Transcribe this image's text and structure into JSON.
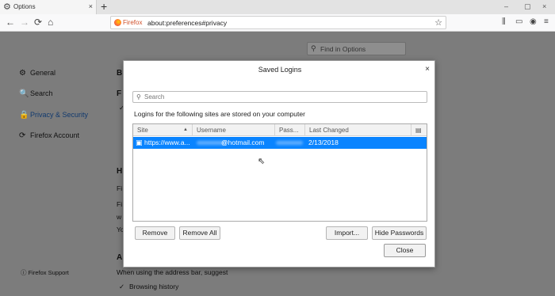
{
  "tab": {
    "title": "Options",
    "close": "×",
    "new_tab": "+"
  },
  "window_controls": {
    "minimize": "‒",
    "restore": "▢",
    "close": "×"
  },
  "nav": {
    "back": "←",
    "forward": "→",
    "reload": "⟳",
    "home": "⌂"
  },
  "urlbar": {
    "identity": "Firefox",
    "url": "about:preferences#privacy",
    "bookmark": "☆"
  },
  "toolbar_icons": {
    "library": "⫼",
    "sidebar": "▭",
    "account": "◉",
    "menu": "≡"
  },
  "page": {
    "find_placeholder": "Find in Options",
    "sidebar": [
      {
        "label": "General",
        "icon": "⚙"
      },
      {
        "label": "Search",
        "icon": "🔍"
      },
      {
        "label": "Privacy & Security",
        "icon": "🔒"
      },
      {
        "label": "Firefox Account",
        "icon": "⟳"
      }
    ],
    "support": "Firefox Support",
    "bg": {
      "b1": "B",
      "f1": "F",
      "check1": "✓",
      "h1": "H",
      "fi1": "Fi",
      "fi2": "Fi",
      "we": "w",
      "yo": "Yo",
      "a1": "A",
      "address_bar": "When using the address bar, suggest",
      "browsing_history": "Browsing history",
      "check2": "✓"
    }
  },
  "dialog": {
    "title": "Saved Logins",
    "close": "×",
    "search_placeholder": "Search",
    "info": "Logins for the following sites are stored on your computer",
    "columns": {
      "site": "Site",
      "sort": "▲",
      "username": "Username",
      "password": "Pass...",
      "last_changed": "Last Changed",
      "picker": "▤"
    },
    "rows": [
      {
        "site": "https://www.a...",
        "username": "@hotmail.com",
        "last_changed": "2/13/2018"
      }
    ],
    "buttons": {
      "remove": "Remove",
      "remove_all": "Remove All",
      "import": "Import...",
      "hide_passwords": "Hide Passwords",
      "close": "Close"
    }
  }
}
